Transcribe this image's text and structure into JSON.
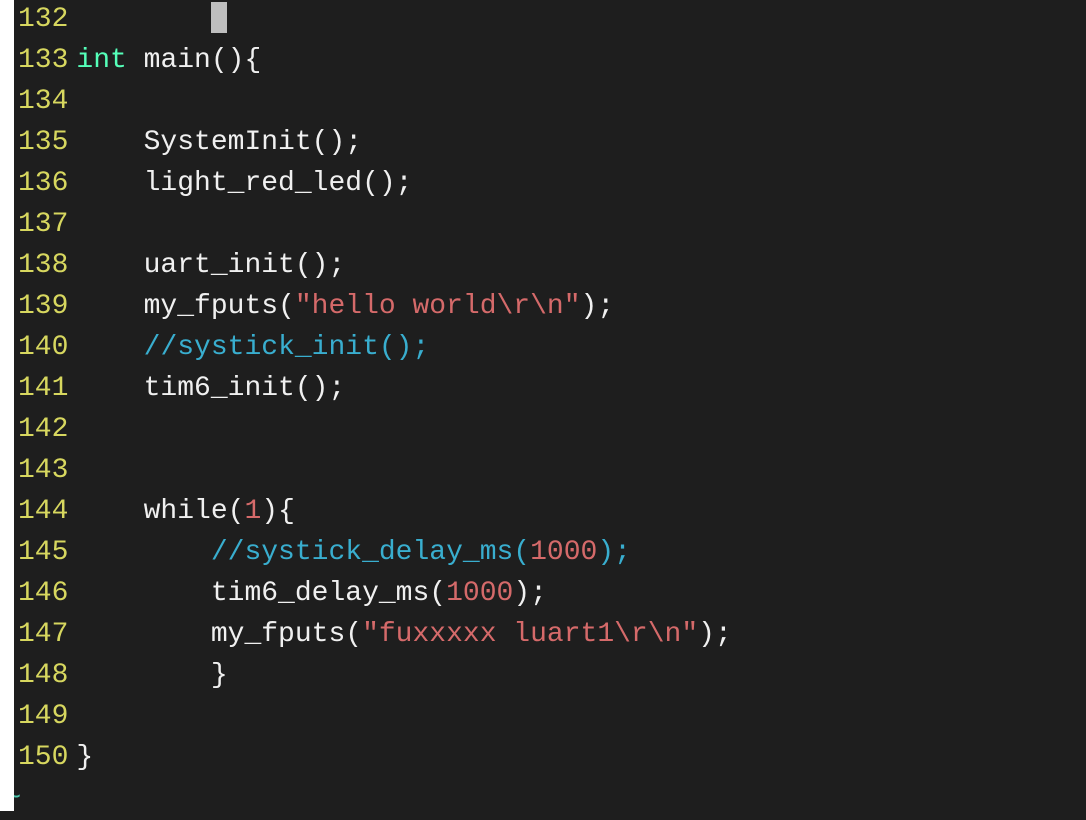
{
  "editor": {
    "first_line": 132,
    "cursor": {
      "line": 132,
      "col": 8
    },
    "tilde": "~",
    "lines": [
      {
        "n": "132",
        "seg": [
          {
            "t": "        ",
            "c": "tok-default"
          }
        ],
        "cursor_after_indent": true,
        "indent": "        "
      },
      {
        "n": "133",
        "seg": [
          {
            "t": "int",
            "c": "tok-type"
          },
          {
            "t": " main(){",
            "c": "tok-default"
          }
        ]
      },
      {
        "n": "134",
        "seg": []
      },
      {
        "n": "135",
        "seg": [
          {
            "t": "    SystemInit();",
            "c": "tok-default"
          }
        ]
      },
      {
        "n": "136",
        "seg": [
          {
            "t": "    light_red_led();",
            "c": "tok-default"
          }
        ]
      },
      {
        "n": "137",
        "seg": []
      },
      {
        "n": "138",
        "seg": [
          {
            "t": "    uart_init();",
            "c": "tok-default"
          }
        ]
      },
      {
        "n": "139",
        "seg": [
          {
            "t": "    my_fputs(",
            "c": "tok-default"
          },
          {
            "t": "\"hello world\\r\\n\"",
            "c": "tok-string"
          },
          {
            "t": ");",
            "c": "tok-default"
          }
        ]
      },
      {
        "n": "140",
        "seg": [
          {
            "t": "    ",
            "c": "tok-default"
          },
          {
            "t": "//systick_init();",
            "c": "tok-comment"
          }
        ]
      },
      {
        "n": "141",
        "seg": [
          {
            "t": "    tim6_init();",
            "c": "tok-default"
          }
        ]
      },
      {
        "n": "142",
        "seg": []
      },
      {
        "n": "143",
        "seg": []
      },
      {
        "n": "144",
        "seg": [
          {
            "t": "    while(",
            "c": "tok-default"
          },
          {
            "t": "1",
            "c": "tok-number"
          },
          {
            "t": "){",
            "c": "tok-default"
          }
        ]
      },
      {
        "n": "145",
        "seg": [
          {
            "t": "        ",
            "c": "tok-default"
          },
          {
            "t": "//systick_delay_ms(",
            "c": "tok-comment"
          },
          {
            "t": "1000",
            "c": "tok-number"
          },
          {
            "t": ");",
            "c": "tok-comment"
          }
        ]
      },
      {
        "n": "146",
        "seg": [
          {
            "t": "        tim6_delay_ms(",
            "c": "tok-default"
          },
          {
            "t": "1000",
            "c": "tok-number"
          },
          {
            "t": ");",
            "c": "tok-default"
          }
        ]
      },
      {
        "n": "147",
        "seg": [
          {
            "t": "        my_fputs(",
            "c": "tok-default"
          },
          {
            "t": "\"fuxxxxx luart1\\r\\n\"",
            "c": "tok-string"
          },
          {
            "t": ");",
            "c": "tok-default"
          }
        ]
      },
      {
        "n": "148",
        "seg": [
          {
            "t": "        }",
            "c": "tok-default"
          }
        ]
      },
      {
        "n": "149",
        "seg": []
      },
      {
        "n": "150",
        "seg": [
          {
            "t": "}",
            "c": "tok-default"
          }
        ]
      }
    ]
  }
}
